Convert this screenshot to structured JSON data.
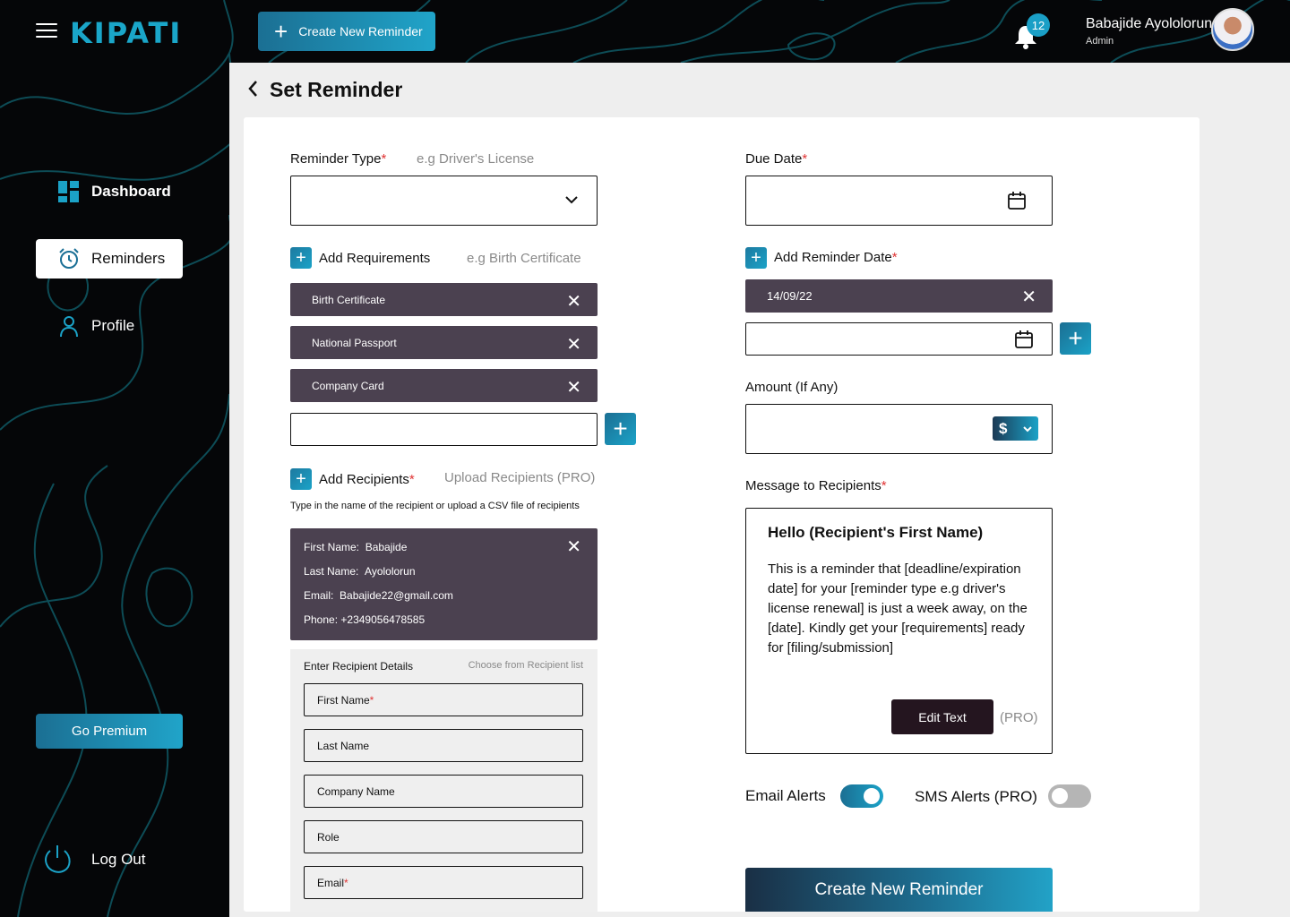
{
  "app": {
    "logo": "KIPATI"
  },
  "topbar": {
    "create_button": "Create New Reminder",
    "notifications_count": "12",
    "user_name": "Babajide Ayololorun",
    "user_role": "Admin"
  },
  "sidebar": {
    "items": [
      {
        "label": "Dashboard",
        "icon": "dashboard-icon",
        "active": false
      },
      {
        "label": "Reminders",
        "icon": "alarm-clock-icon",
        "active": true
      },
      {
        "label": "Profile",
        "icon": "user-icon",
        "active": false
      }
    ],
    "premium_button": "Go Premium",
    "logout": "Log Out"
  },
  "page": {
    "title": "Set Reminder"
  },
  "form": {
    "reminder_type": {
      "label": "Reminder Type",
      "required": "*",
      "hint": "e.g Driver's License",
      "value": ""
    },
    "requirements": {
      "label": "Add Requirements",
      "hint": "e.g Birth Certificate",
      "items": [
        "Birth Certificate",
        "National Passport",
        "Company Card"
      ],
      "input_value": ""
    },
    "recipients": {
      "label": "Add Recipients",
      "required": "*",
      "upload_label": "Upload Recipients (PRO)",
      "helper": "Type in the name of the recipient or upload a CSV file of recipients",
      "card": {
        "first_name_label": "First Name:",
        "first_name": "Babajide",
        "last_name_label": "Last Name:",
        "last_name": "Ayololorun",
        "email_label": "Email:",
        "email": "Babajide22@gmail.com",
        "phone_label": "Phone:",
        "phone": "+2349056478585"
      },
      "details": {
        "title": "Enter Recipient Details",
        "choose": "Choose from Recipient list",
        "fields": [
          "First Name",
          "Last Name",
          "Company Name",
          "Role",
          "Email"
        ]
      }
    },
    "due_date": {
      "label": "Due Date",
      "required": "*",
      "value": ""
    },
    "reminder_date": {
      "label": "Add Reminder Date",
      "required": "*",
      "dates": [
        "14/09/22"
      ],
      "input_value": ""
    },
    "amount": {
      "label": "Amount (If Any)",
      "currency": "$",
      "value": ""
    },
    "message": {
      "label": "Message to Recipients",
      "required": "*",
      "title": "Hello (Recipient's First Name)",
      "body": "This is a reminder that [deadline/expiration date] for your [reminder type e.g driver's license renewal] is just a week away, on the [date]. Kindly get your [requirements] ready for [filing/submission]",
      "edit_button": "Edit Text",
      "pro_tag": "(PRO)"
    },
    "alerts": {
      "email_label": "Email Alerts",
      "email_on": true,
      "sms_label": "SMS Alerts (PRO)",
      "sms_on": false
    },
    "submit_button": "Create New Reminder"
  },
  "colors": {
    "accent": "#1ba2c7",
    "chip": "#4b4150",
    "dark_button": "#24151f",
    "required": "#e03434"
  }
}
